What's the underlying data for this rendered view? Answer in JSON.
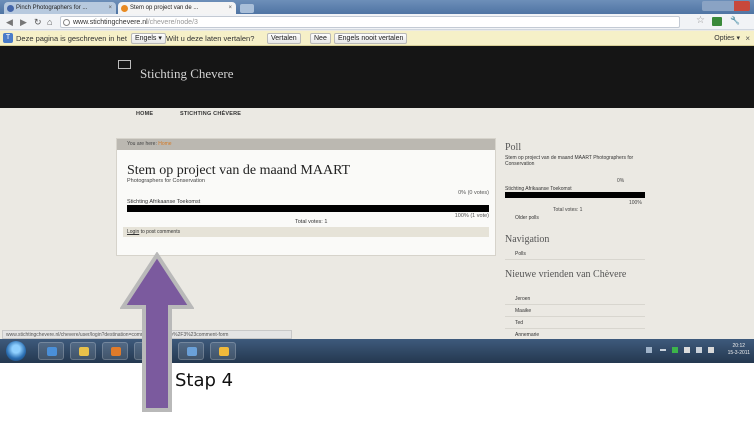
{
  "browser": {
    "tabs": [
      {
        "label": "Pinch Photographers for ..."
      },
      {
        "label": "Stem op project van de ..."
      }
    ],
    "address": {
      "url_host": "www.stichtingchevere.nl",
      "url_path": "/chevere/node/3"
    },
    "status_url": "www.stichtingchevere.nl/chevere/user/login?destination=comment%2Freply%2F3%23comment-form"
  },
  "translate_bar": {
    "message": "Deze pagina is geschreven in het",
    "language": "Engels ▾",
    "question": "Wilt u deze laten vertalen?",
    "translate_button": "Vertalen",
    "no_button": "Nee",
    "never_button": "Engels nooit vertalen",
    "options": "Opties ▾",
    "close": "×"
  },
  "site": {
    "title": "Stichting Chevere",
    "nav": [
      "HOME",
      "STICHTING CHÉVERE"
    ]
  },
  "main": {
    "breadcrumb_prefix": "You are here:",
    "breadcrumb_link": "Home",
    "poll_title": "Stem op project van de maand MAART",
    "poll_subtitle": "Photographers for Conservation",
    "pct_first": "0% (0 votes)",
    "choice": "Stichting Afrikaanse Toekomst",
    "vote_fraction": 1.0,
    "pct_second": "100% (1 vote)",
    "total": "Total votes: 1",
    "login_link": "Login",
    "login_rest": " to post comments"
  },
  "sidebar": {
    "poll_heading": "Poll",
    "question": "Stem op project van de maand MAART Photographers for Conservation",
    "pct_first": "0%",
    "choice": "Stichting Afrikaanse Toekomst",
    "vote_fraction": 1.0,
    "pct_second": "100%",
    "total": "Total votes: 1",
    "older_polls": "Older polls",
    "nav_heading": "Navigation",
    "nav_items": [
      "Polls"
    ],
    "friends_heading": "Nieuwe vrienden van Chèvere",
    "friends": [
      "Jeroen",
      "Maaike",
      "Ted",
      "Annemarie"
    ]
  },
  "taskbar": {
    "clock_time": "20:12",
    "clock_date": "15-3-2011"
  },
  "annotation": {
    "label": "Stap 4",
    "arrow_color": "#7b5a9e"
  }
}
